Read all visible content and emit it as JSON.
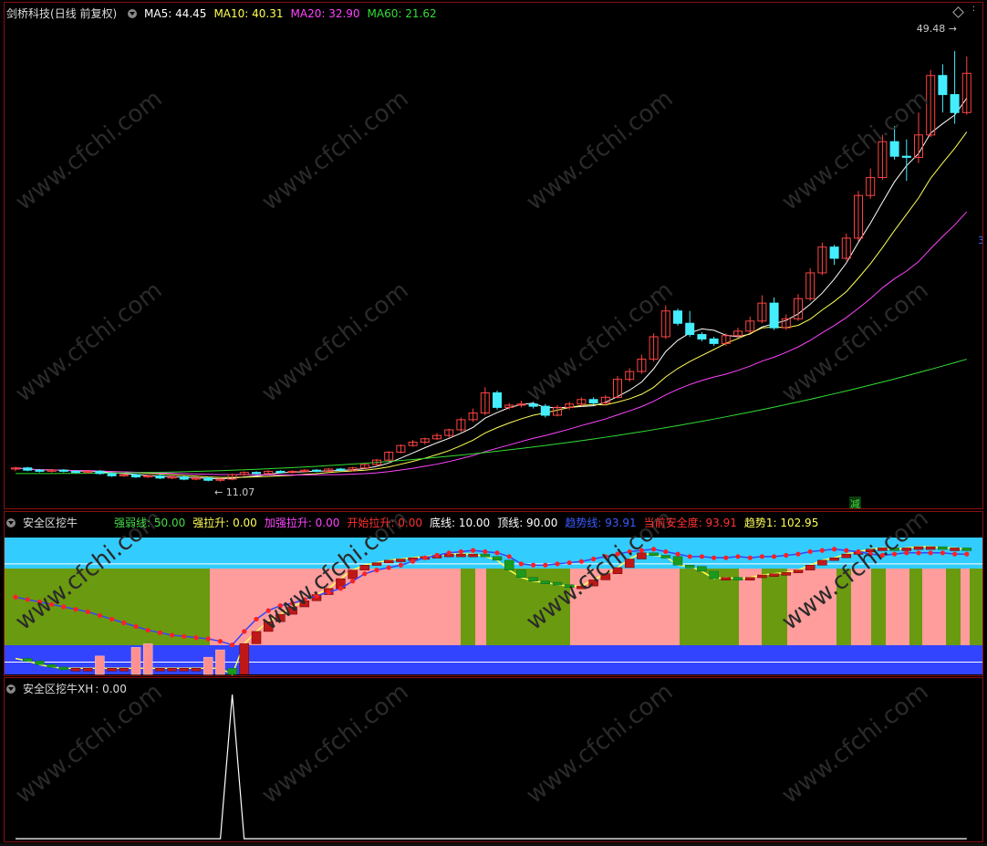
{
  "panels": {
    "main": {
      "stock_name": "剑桥科技",
      "period": "(日线 前复权)",
      "ma": [
        {
          "label": "MA5:",
          "value": "44.45",
          "color": "#ffffff"
        },
        {
          "label": "MA10:",
          "value": "40.31",
          "color": "#ffff55"
        },
        {
          "label": "MA20:",
          "value": "32.90",
          "color": "#ff44ff"
        },
        {
          "label": "MA60:",
          "value": "21.62",
          "color": "#33dd33"
        }
      ],
      "high_label": "49.48",
      "low_label": "11.07",
      "reduce_label": "减",
      "axis_partial": "3"
    },
    "indicator": {
      "name": "安全区挖牛",
      "params": [
        {
          "label": "强弱线:",
          "value": "50.00",
          "color": "#44dd44"
        },
        {
          "label": "强拉升:",
          "value": "0.00",
          "color": "#ffff55"
        },
        {
          "label": "加强拉升:",
          "value": "0.00",
          "color": "#ff44ff"
        },
        {
          "label": "开始拉升:",
          "value": "0.00",
          "color": "#ff3030"
        },
        {
          "label": "底线:",
          "value": "10.00",
          "color": "#ffffff"
        },
        {
          "label": "顶线:",
          "value": "90.00",
          "color": "#ffffff"
        },
        {
          "label": "趋势线:",
          "value": "93.91",
          "color": "#3b5bff"
        },
        {
          "label": "当前安全度:",
          "value": "93.91",
          "color": "#ff3030"
        },
        {
          "label": "趋势1:",
          "value": "102.95",
          "color": "#ffff55"
        }
      ]
    },
    "xh": {
      "name": "安全区挖牛XH",
      "value_label": ": 0.00"
    }
  },
  "watermark": "www.cfchi.com",
  "colors": {
    "up": "#ff4444",
    "down": "#44eeff",
    "ma5": "#ffffff",
    "ma10": "#ffff55",
    "ma20": "#ff44ff",
    "ma60": "#33dd33",
    "pink": "#ff9c9c",
    "olive": "#6a9a10",
    "sky": "#33ccff",
    "blue": "#3344ff"
  },
  "chart_data": [
    {
      "type": "candlestick",
      "title": "剑桥科技",
      "ylim": [
        10,
        52
      ],
      "candles": [
        [
          12.2,
          12.3,
          12.4,
          12.0
        ],
        [
          12.3,
          12.1,
          12.4,
          12.0
        ],
        [
          12.1,
          12.0,
          12.2,
          11.9
        ],
        [
          12.0,
          12.1,
          12.2,
          11.9
        ],
        [
          12.1,
          12.0,
          12.2,
          11.9
        ],
        [
          12.0,
          11.9,
          12.1,
          11.8
        ],
        [
          11.9,
          12.0,
          12.1,
          11.8
        ],
        [
          12.0,
          11.8,
          12.1,
          11.7
        ],
        [
          11.8,
          11.6,
          11.9,
          11.5
        ],
        [
          11.6,
          11.7,
          11.8,
          11.5
        ],
        [
          11.7,
          11.5,
          11.8,
          11.4
        ],
        [
          11.5,
          11.6,
          11.7,
          11.4
        ],
        [
          11.6,
          11.4,
          11.7,
          11.3
        ],
        [
          11.4,
          11.5,
          11.6,
          11.3
        ],
        [
          11.5,
          11.3,
          11.6,
          11.2
        ],
        [
          11.3,
          11.4,
          11.5,
          11.2
        ],
        [
          11.4,
          11.2,
          11.5,
          11.1
        ],
        [
          11.2,
          11.3,
          11.4,
          11.07
        ],
        [
          11.3,
          11.7,
          11.8,
          11.2
        ],
        [
          11.7,
          11.9,
          12.0,
          11.6
        ],
        [
          11.9,
          11.8,
          12.0,
          11.7
        ],
        [
          11.8,
          12.0,
          12.1,
          11.7
        ],
        [
          12.0,
          11.9,
          12.1,
          11.8
        ],
        [
          11.9,
          12.0,
          12.1,
          11.8
        ],
        [
          12.0,
          12.1,
          12.2,
          11.9
        ],
        [
          12.1,
          12.0,
          12.2,
          11.9
        ],
        [
          12.0,
          12.2,
          12.3,
          11.9
        ],
        [
          12.2,
          12.1,
          12.3,
          12.0
        ],
        [
          12.1,
          12.3,
          12.4,
          12.0
        ],
        [
          12.3,
          12.6,
          12.7,
          12.2
        ],
        [
          12.6,
          13.0,
          13.1,
          12.5
        ],
        [
          13.0,
          13.7,
          13.8,
          12.9
        ],
        [
          13.7,
          14.3,
          14.4,
          13.6
        ],
        [
          14.3,
          14.6,
          14.8,
          14.2
        ],
        [
          14.6,
          14.9,
          15.0,
          14.4
        ],
        [
          14.9,
          15.2,
          15.4,
          14.8
        ],
        [
          15.2,
          15.7,
          15.8,
          15.0
        ],
        [
          15.7,
          16.6,
          16.8,
          15.5
        ],
        [
          16.6,
          17.2,
          17.6,
          16.4
        ],
        [
          17.2,
          19.0,
          19.5,
          17.0
        ],
        [
          19.0,
          17.7,
          19.2,
          17.5
        ],
        [
          17.7,
          17.9,
          18.1,
          17.5
        ],
        [
          17.9,
          18.0,
          18.3,
          17.7
        ],
        [
          18.0,
          17.8,
          18.2,
          17.6
        ],
        [
          17.8,
          17.0,
          18.0,
          16.8
        ],
        [
          17.0,
          17.7,
          17.9,
          16.9
        ],
        [
          17.7,
          18.0,
          18.2,
          17.5
        ],
        [
          18.0,
          18.4,
          18.6,
          17.8
        ],
        [
          18.4,
          18.1,
          18.6,
          17.9
        ],
        [
          18.1,
          18.6,
          18.8,
          17.9
        ],
        [
          18.6,
          20.2,
          20.5,
          18.5
        ],
        [
          20.2,
          20.9,
          21.2,
          20.0
        ],
        [
          20.9,
          22.0,
          22.4,
          20.7
        ],
        [
          22.0,
          24.0,
          24.3,
          21.8
        ],
        [
          24.0,
          26.3,
          26.8,
          23.8
        ],
        [
          26.3,
          25.2,
          26.5,
          25.0
        ],
        [
          25.2,
          24.2,
          26.3,
          24.0
        ],
        [
          24.2,
          23.8,
          24.4,
          23.6
        ],
        [
          23.8,
          23.4,
          24.0,
          23.2
        ],
        [
          23.4,
          24.1,
          24.3,
          23.2
        ],
        [
          24.1,
          24.5,
          24.8,
          23.9
        ],
        [
          24.5,
          25.4,
          25.8,
          24.3
        ],
        [
          25.4,
          27.0,
          27.7,
          25.2
        ],
        [
          27.0,
          24.8,
          27.5,
          24.6
        ],
        [
          24.8,
          25.6,
          26.0,
          24.6
        ],
        [
          25.6,
          27.4,
          27.8,
          25.4
        ],
        [
          27.4,
          29.7,
          30.1,
          27.2
        ],
        [
          29.7,
          32.0,
          32.4,
          29.5
        ],
        [
          32.0,
          31.0,
          32.2,
          30.4
        ],
        [
          31.0,
          32.8,
          33.2,
          30.8
        ],
        [
          32.8,
          36.6,
          37.0,
          32.5
        ],
        [
          36.6,
          38.2,
          39.0,
          36.3
        ],
        [
          38.2,
          41.4,
          42.0,
          38.0
        ],
        [
          41.4,
          40.1,
          42.8,
          39.8
        ],
        [
          40.1,
          40.0,
          41.6,
          37.9
        ],
        [
          40.0,
          42.0,
          44.0,
          39.5
        ],
        [
          42.0,
          47.3,
          47.8,
          41.8
        ],
        [
          47.3,
          45.6,
          48.3,
          44.0
        ],
        [
          45.6,
          44.0,
          49.48,
          43.0
        ],
        [
          44.0,
          47.5,
          49.0,
          43.8
        ]
      ]
    },
    {
      "type": "line",
      "title": "安全区挖牛",
      "ylim": [
        0,
        110
      ],
      "series": [
        {
          "name": "当前安全度",
          "values": [
            63,
            61,
            59,
            57,
            55,
            53,
            51,
            48,
            45,
            42,
            39,
            36,
            34,
            32,
            31,
            30,
            29,
            27,
            24,
            35,
            45,
            52,
            56,
            58,
            61,
            64,
            67,
            70,
            76,
            82,
            85,
            87,
            89,
            92,
            95,
            97,
            99,
            100,
            101,
            100,
            99,
            96,
            90,
            89,
            89,
            90,
            91,
            92,
            94,
            96,
            98,
            100,
            101,
            102,
            100,
            98,
            96,
            96,
            95,
            95,
            96,
            95,
            96,
            96,
            97,
            98,
            100,
            101,
            102,
            101,
            100,
            98,
            97,
            98,
            99,
            99,
            99,
            99,
            98,
            98
          ]
        },
        {
          "name": "趋势1",
          "values": [
            13,
            11,
            8,
            6,
            5,
            5,
            5,
            5,
            5,
            5,
            5,
            5,
            5,
            5,
            5,
            5,
            5,
            5,
            0,
            25,
            35,
            43,
            49,
            55,
            60,
            65,
            70,
            78,
            85,
            89,
            91,
            93,
            94,
            95,
            96,
            97,
            98,
            98,
            98,
            96,
            93,
            85,
            79,
            76,
            75,
            73,
            72,
            72,
            77,
            82,
            87,
            94,
            99,
            97,
            96,
            89,
            88,
            84,
            78,
            79,
            78,
            79,
            81,
            82,
            83,
            85,
            89,
            93,
            95,
            98,
            100,
            102,
            103,
            102,
            103,
            104,
            104,
            103,
            103,
            102
          ]
        }
      ]
    },
    {
      "type": "line",
      "title": "安全区挖牛XH",
      "series": [
        {
          "name": "安全区挖牛XH",
          "values": [
            0,
            0,
            0,
            0,
            0,
            0,
            0,
            0,
            0,
            0,
            0,
            0,
            0,
            0,
            0,
            0,
            0,
            0,
            1,
            0,
            0,
            0,
            0,
            0,
            0,
            0,
            0,
            0,
            0,
            0,
            0,
            0,
            0,
            0,
            0,
            0,
            0,
            0,
            0,
            0,
            0,
            0,
            0,
            0,
            0,
            0,
            0,
            0,
            0,
            0,
            0,
            0,
            0,
            0,
            0,
            0,
            0,
            0,
            0,
            0,
            0,
            0,
            0,
            0,
            0,
            0,
            0,
            0,
            0,
            0,
            0,
            0,
            0,
            0,
            0,
            0,
            0,
            0,
            0,
            0
          ]
        }
      ]
    }
  ]
}
